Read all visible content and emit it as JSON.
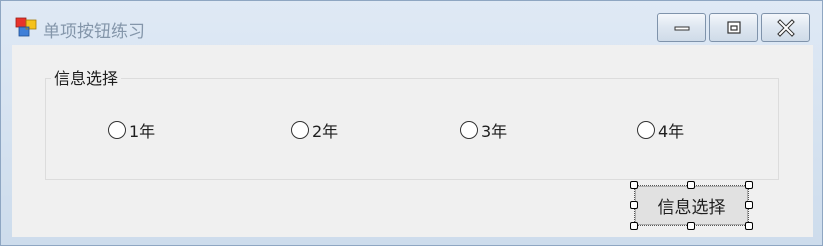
{
  "window": {
    "title": "单项按钮练习",
    "controls": {
      "minimize_icon": "minimize-icon",
      "maximize_icon": "maximize-icon",
      "close_icon": "close-icon"
    }
  },
  "form": {
    "group": {
      "label": "信息选择",
      "options": [
        {
          "label": "1年",
          "checked": false
        },
        {
          "label": "2年",
          "checked": false
        },
        {
          "label": "3年",
          "checked": false
        },
        {
          "label": "4年",
          "checked": false
        }
      ]
    },
    "button": {
      "label": "信息选择",
      "selected_in_designer": true
    }
  },
  "colors": {
    "window_frame": "#cddcec",
    "client_background": "#f0f0f0",
    "button_background": "#e1e1e1",
    "title_text": "#8496aa"
  }
}
